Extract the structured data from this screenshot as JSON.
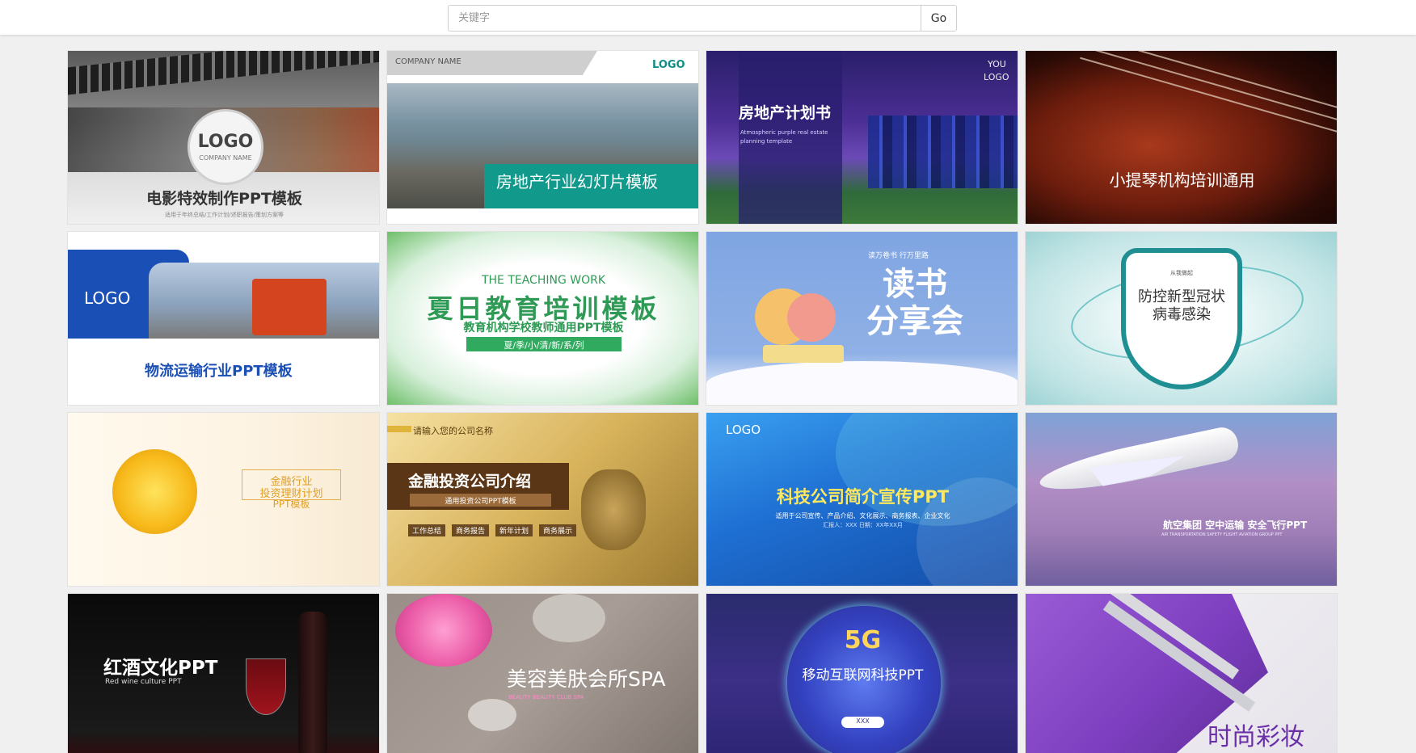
{
  "search": {
    "placeholder": "关键字",
    "button_label": "Go"
  },
  "cards": [
    {
      "title": "电影特效制作PPT模板",
      "logo": "LOGO",
      "company": "COMPANY NAME",
      "subtitle": "适用于年终总结/工作计划/述职报告/策划方案等"
    },
    {
      "title": "房地产行业幻灯片模板",
      "company": "COMPANY NAME",
      "logo": "LOGO"
    },
    {
      "title": "房地产计划书",
      "logo_line1": "YOU",
      "logo_line2": "LOGO",
      "subtitle": "Atmospheric purple real estate planning template"
    },
    {
      "title": "小提琴机构培训通用"
    },
    {
      "title": "物流运输行业PPT模板",
      "logo": "LOGO"
    },
    {
      "title": "夏日教育培训模板",
      "eyebrow": "THE TEACHING WORK",
      "subtitle": "教育机构学校教师通用PPT模板",
      "tagline": "夏/季/小/清/新/系/列"
    },
    {
      "title_line1": "读书",
      "title_line2": "分享会",
      "eyebrow": "读万卷书 行万里路"
    },
    {
      "title_line1": "防控新型冠状",
      "title_line2": "病毒感染",
      "eyebrow": "从我做起"
    },
    {
      "title_line1": "金融行业",
      "title_line2": "投资理财计划",
      "title_line3": "PPT模板"
    },
    {
      "title": "金融投资公司介绍",
      "eyebrow": "请输入您的公司名称",
      "subtitle": "通用投资公司PPT模板",
      "tags": [
        "工作总结",
        "商务报告",
        "新年计划",
        "商务展示"
      ]
    },
    {
      "title": "科技公司简介宣传PPT",
      "logo": "LOGO",
      "subtitle": "适用于公司宣传、产品介绍、文化展示、商务报表、企业文化",
      "meta": "汇报人：XXX 日期：XX年XX月"
    },
    {
      "title": "航空集团 空中运输 安全飞行PPT",
      "subtitle": "AIR TRANSPORTATION SAFETY FLIGHT AVIATION GROUP PPT"
    },
    {
      "title": "红酒文化PPT",
      "subtitle": "Red wine culture PPT"
    },
    {
      "title": "美容美肤会所SPA",
      "subtitle": "BEAUTY BEAUTY CLUB SPA"
    },
    {
      "title": "移动互联网科技PPT",
      "badge": "5G",
      "button": "XXX"
    },
    {
      "title": "时尚彩妆"
    }
  ]
}
